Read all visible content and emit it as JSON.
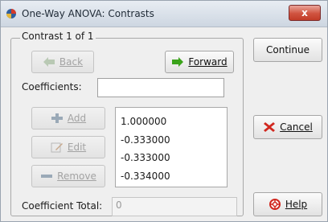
{
  "window": {
    "title": "One-Way ANOVA: Contrasts"
  },
  "titlebar": {
    "close_glyph": "x"
  },
  "group": {
    "title": "Contrast 1 of 1"
  },
  "buttons": {
    "back": "Back",
    "forward": "Forward",
    "add": "Add",
    "edit": "Edit",
    "remove": "Remove",
    "continue": "Continue",
    "cancel": "Cancel",
    "help": "Help"
  },
  "fields": {
    "coefficients_label": "Coefficients:",
    "coefficients_value": "",
    "coefficient_total_label": "Coefficient Total:",
    "coefficient_total_value": "0"
  },
  "coefficients_list": [
    "1.000000",
    "-0.333000",
    "-0.333000",
    "-0.334000"
  ],
  "icons": {
    "app": "app-icon",
    "back": "arrow-left-icon",
    "forward": "arrow-right-icon",
    "add": "plus-icon",
    "edit": "pencil-icon",
    "remove": "minus-icon",
    "cancel": "cancel-x-icon",
    "help": "help-lifebuoy-icon"
  },
  "colors": {
    "arrow_green": "#3aa31a",
    "cancel_red": "#d1281f",
    "close_red": "#c94a36"
  }
}
